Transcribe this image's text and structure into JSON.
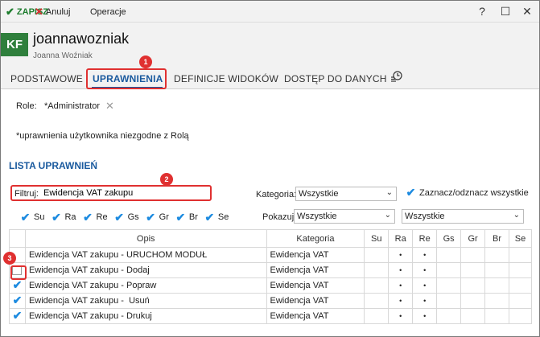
{
  "toolbar": {
    "save_label": "ZAPISZ",
    "cancel_label": "Anuluj",
    "operations_label": "Operacje",
    "help_label": "?",
    "maximize_label": "☐",
    "close_label": "✕"
  },
  "header": {
    "avatar_initials": "KF",
    "login": "joannawozniak",
    "full_name": "Joanna Woźniak"
  },
  "tabs": [
    {
      "label": "PODSTAWOWE"
    },
    {
      "label": "UPRAWNIENIA"
    },
    {
      "label": "DEFINICJE WIDOKÓW"
    },
    {
      "label": "DOSTĘP DO DANYCH"
    }
  ],
  "history_icon": "history-icon",
  "roles": {
    "label": "Role:",
    "value": "*Administrator"
  },
  "note": "*uprawnienia użytkownika niezgodne z Rolą",
  "section_title": "LISTA UPRAWNIEŃ",
  "filter": {
    "label": "Filtruj:",
    "value": "Ewidencja VAT zakupu"
  },
  "category": {
    "label": "Kategoria:",
    "selected": "Wszystkie"
  },
  "toggle_all_label": "Zaznacz/odznacz wszystkie",
  "column_filters": [
    "Su",
    "Ra",
    "Re",
    "Gs",
    "Gr",
    "Br",
    "Se"
  ],
  "show": {
    "label": "Pokazuj:",
    "selected": "Wszystkie",
    "selected2": "Wszystkie"
  },
  "badges": [
    "1",
    "2",
    "3"
  ],
  "table": {
    "headers": [
      "Opis",
      "Kategoria",
      "Su",
      "Ra",
      "Re",
      "Gs",
      "Gr",
      "Br",
      "Se"
    ],
    "rows": [
      {
        "checked": null,
        "opis": "Ewidencja VAT zakupu - URUCHOM MODUŁ",
        "kategoria": "Ewidencja VAT",
        "ra": "•",
        "re": "•"
      },
      {
        "checked": false,
        "opis": "Ewidencja VAT zakupu - Dodaj",
        "kategoria": "Ewidencja VAT",
        "ra": "•",
        "re": "•"
      },
      {
        "checked": true,
        "opis": "Ewidencja VAT zakupu - Popraw",
        "kategoria": "Ewidencja VAT",
        "ra": "•",
        "re": "•"
      },
      {
        "checked": true,
        "opis": "Ewidencja VAT zakupu -  Usuń",
        "kategoria": "Ewidencja VAT",
        "ra": "•",
        "re": "•"
      },
      {
        "checked": true,
        "opis": "Ewidencja VAT zakupu - Drukuj",
        "kategoria": "Ewidencja VAT",
        "ra": "•",
        "re": "•"
      }
    ]
  },
  "colors": {
    "accent": "#1a5a9e",
    "brand_green": "#2f7f3c",
    "highlight_red": "#e03030",
    "check_blue": "#1d8be0"
  }
}
